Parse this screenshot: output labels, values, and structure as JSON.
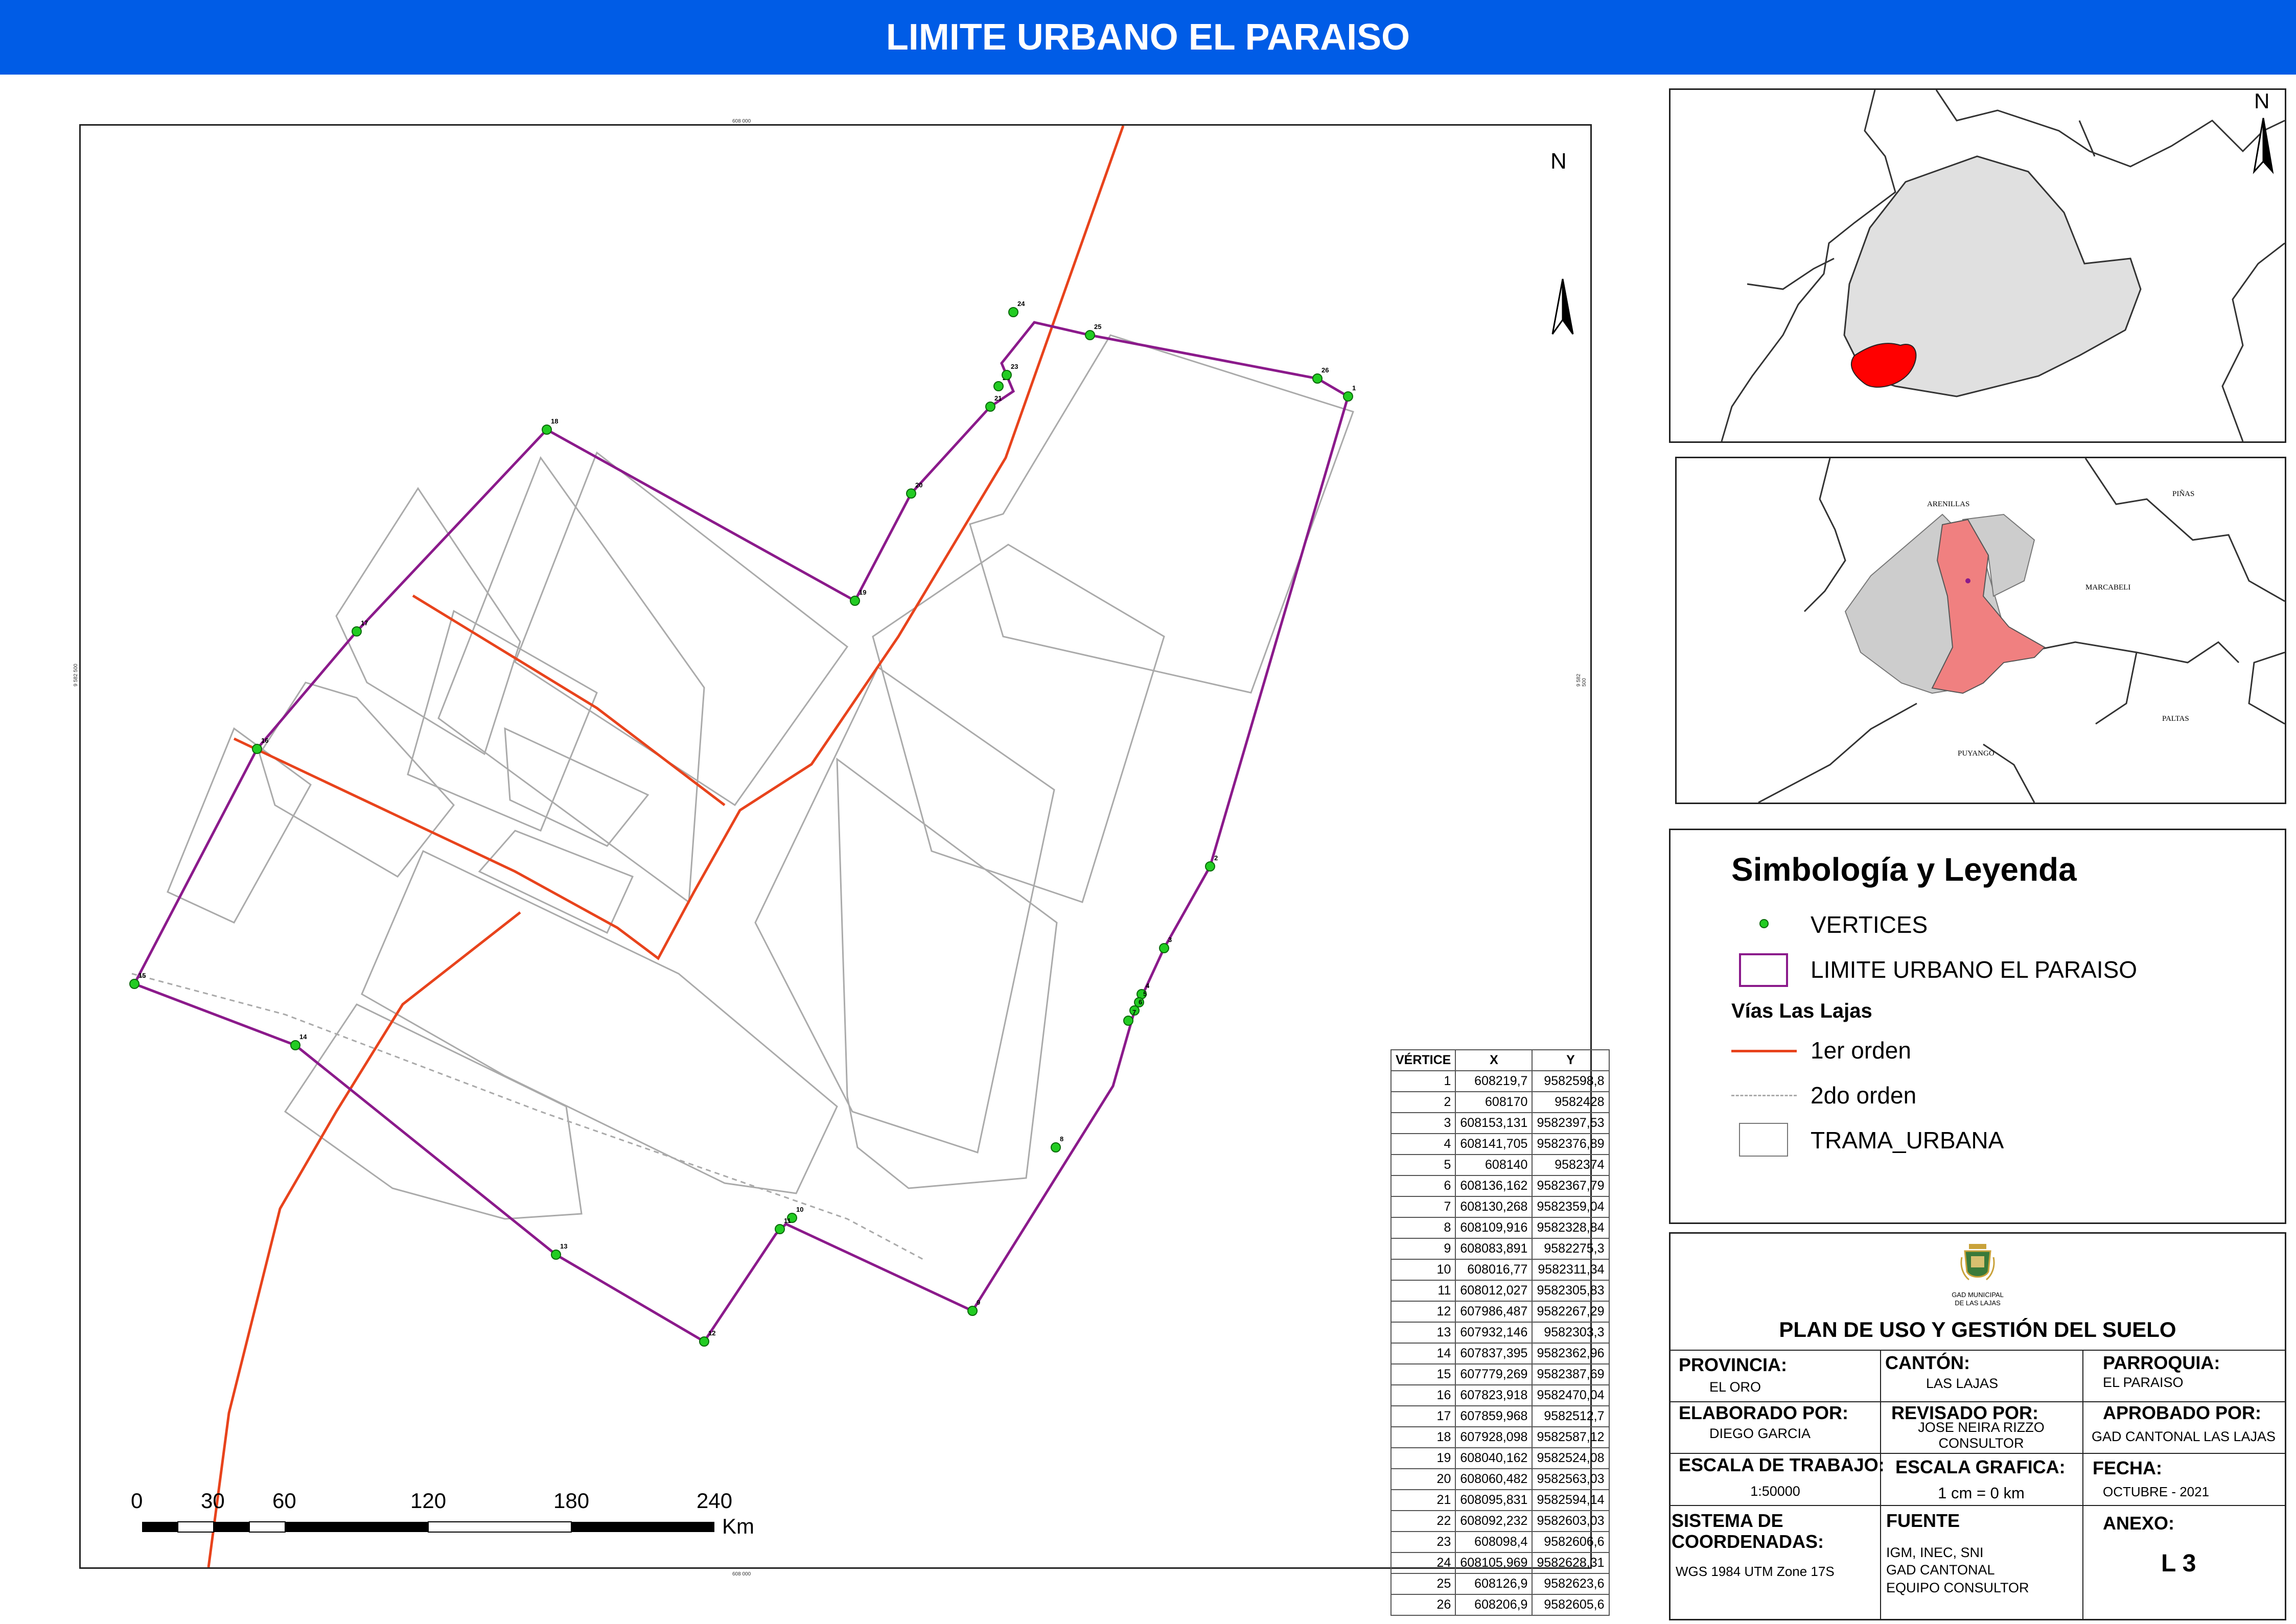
{
  "title": "LIMITE URBANO EL PARAISO",
  "north_label": "N",
  "grid_ticks": {
    "top": "608 000",
    "bottom": "608 000",
    "left": "9 582 500",
    "right": "9 582 500"
  },
  "vertices": [
    {
      "id": "1",
      "x": "608219,7",
      "y": "9582598,8"
    },
    {
      "id": "2",
      "x": "608170",
      "y": "9582428"
    },
    {
      "id": "3",
      "x": "608153,131",
      "y": "9582397,53"
    },
    {
      "id": "4",
      "x": "608141,705",
      "y": "9582376,89"
    },
    {
      "id": "5",
      "x": "608140",
      "y": "9582374"
    },
    {
      "id": "6",
      "x": "608136,162",
      "y": "9582367,79"
    },
    {
      "id": "7",
      "x": "608130,268",
      "y": "9582359,04"
    },
    {
      "id": "8",
      "x": "608109,916",
      "y": "9582328,84"
    },
    {
      "id": "9",
      "x": "608083,891",
      "y": "9582275,3"
    },
    {
      "id": "10",
      "x": "608016,77",
      "y": "9582311,34"
    },
    {
      "id": "11",
      "x": "608012,027",
      "y": "9582305,83"
    },
    {
      "id": "12",
      "x": "607986,487",
      "y": "9582267,29"
    },
    {
      "id": "13",
      "x": "607932,146",
      "y": "9582303,3"
    },
    {
      "id": "14",
      "x": "607837,395",
      "y": "9582362,96"
    },
    {
      "id": "15",
      "x": "607779,269",
      "y": "9582387,69"
    },
    {
      "id": "16",
      "x": "607823,918",
      "y": "9582470,04"
    },
    {
      "id": "17",
      "x": "607859,968",
      "y": "9582512,7"
    },
    {
      "id": "18",
      "x": "607928,098",
      "y": "9582587,12"
    },
    {
      "id": "19",
      "x": "608040,162",
      "y": "9582524,08"
    },
    {
      "id": "20",
      "x": "608060,482",
      "y": "9582563,03"
    },
    {
      "id": "21",
      "x": "608095,831",
      "y": "9582594,14"
    },
    {
      "id": "22",
      "x": "608092,232",
      "y": "9582603,03"
    },
    {
      "id": "23",
      "x": "608098,4",
      "y": "9582606,6"
    },
    {
      "id": "24",
      "x": "608105,969",
      "y": "9582628,31"
    },
    {
      "id": "25",
      "x": "608126,9",
      "y": "9582623,6"
    },
    {
      "id": "26",
      "x": "608206,9",
      "y": "9582605,6"
    }
  ],
  "table_headers": {
    "id": "VÉRTICE",
    "x": "X",
    "y": "Y"
  },
  "scale_bar": {
    "labels": [
      "0",
      "30",
      "60",
      "120",
      "180",
      "240"
    ],
    "unit": "Km"
  },
  "regional_labels": {
    "arenillas": "ARENILLAS",
    "pinas": "PIÑAS",
    "marcabeli": "MARCABELI",
    "paltas": "PALTAS",
    "puyango": "PUYANGO"
  },
  "legend": {
    "title": "Simbología y Leyenda",
    "vertices": "VERTICES",
    "limit": "LIMITE URBANO EL PARAISO",
    "roads_title": "Vías Las Lajas",
    "road1": "1er orden",
    "road2": "2do orden",
    "urban": "TRAMA_URBANA",
    "colors": {
      "vertex": "#22cc22",
      "limit": "#8b1a8b",
      "road1": "#e8431c",
      "road2": "#aaaaaa",
      "urban": "#cfcfcf",
      "highlight": "#ff0000",
      "highlight_light": "#f08080"
    }
  },
  "info": {
    "logo_text_1": "GAD MUNICIPAL",
    "logo_text_2": "DE LAS LAJAS",
    "plan_title": "PLAN DE USO Y GESTIÓN DEL SUELO",
    "provincia_label": "PROVINCIA:",
    "provincia": "EL ORO",
    "canton_label": "CANTÓN:",
    "canton": "LAS LAJAS",
    "parroquia_label": "PARROQUIA:",
    "parroquia": "EL PARAISO",
    "elaborado_label": "ELABORADO POR:",
    "elaborado": "DIEGO GARCIA",
    "revisado_label": "REVISADO POR:",
    "revisado_1": "JOSE NEIRA RIZZO",
    "revisado_2": "CONSULTOR",
    "aprobado_label": "APROBADO POR:",
    "aprobado": "GAD CANTONAL LAS LAJAS",
    "escala_trabajo_label": "ESCALA DE TRABAJO:",
    "escala_trabajo": "1:50000",
    "escala_grafica_label": "ESCALA GRAFICA:",
    "escala_grafica": "1 cm = 0 km",
    "fecha_label": "FECHA:",
    "fecha": "OCTUBRE - 2021",
    "sistema_label_1": "SISTEMA DE",
    "sistema_label_2": "COORDENADAS:",
    "sistema": "WGS 1984 UTM Zone 17S",
    "fuente_label": "FUENTE",
    "fuente_1": "IGM, INEC, SNI",
    "fuente_2": "GAD CANTONAL",
    "fuente_3": "EQUIPO CONSULTOR",
    "anexo_label": "ANEXO:",
    "anexo": "L 3"
  }
}
